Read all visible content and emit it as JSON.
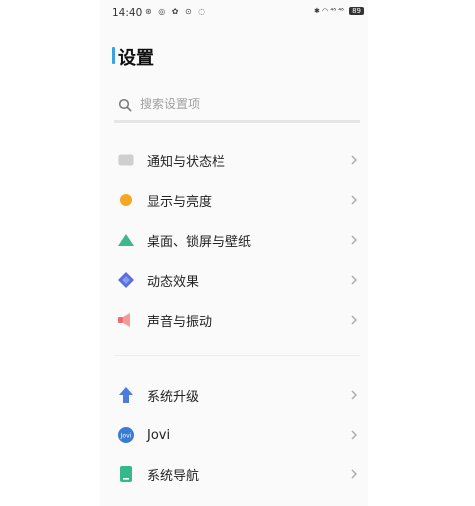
{
  "status_bar": {
    "time": "14:40",
    "left_icons": "⊛ ◎ ✿ ⊙ ◌",
    "signal_text": "⁴⁶ ⁴⁶",
    "battery": "89"
  },
  "page": {
    "title": "设置"
  },
  "search": {
    "placeholder": "搜索设置项"
  },
  "sections": [
    {
      "items": [
        {
          "label": "通知与状态栏",
          "icon": "notification-bar-icon",
          "color": "#c9c9c9"
        },
        {
          "label": "显示与亮度",
          "icon": "brightness-icon",
          "color": "#f5a623"
        },
        {
          "label": "桌面、锁屏与壁纸",
          "icon": "wallpaper-icon",
          "color": "#3fb68e"
        },
        {
          "label": "动态效果",
          "icon": "motion-effects-icon",
          "color": "#5b6ee1"
        },
        {
          "label": "声音与振动",
          "icon": "sound-icon",
          "color": "#ee6b6b"
        }
      ]
    },
    {
      "items": [
        {
          "label": "系统升级",
          "icon": "system-update-icon",
          "color": "#4c7be0"
        },
        {
          "label": "Jovi",
          "icon": "jovi-icon",
          "color": "#3a7bd5"
        },
        {
          "label": "系统导航",
          "icon": "system-navigation-icon",
          "color": "#33b98a"
        }
      ]
    }
  ]
}
